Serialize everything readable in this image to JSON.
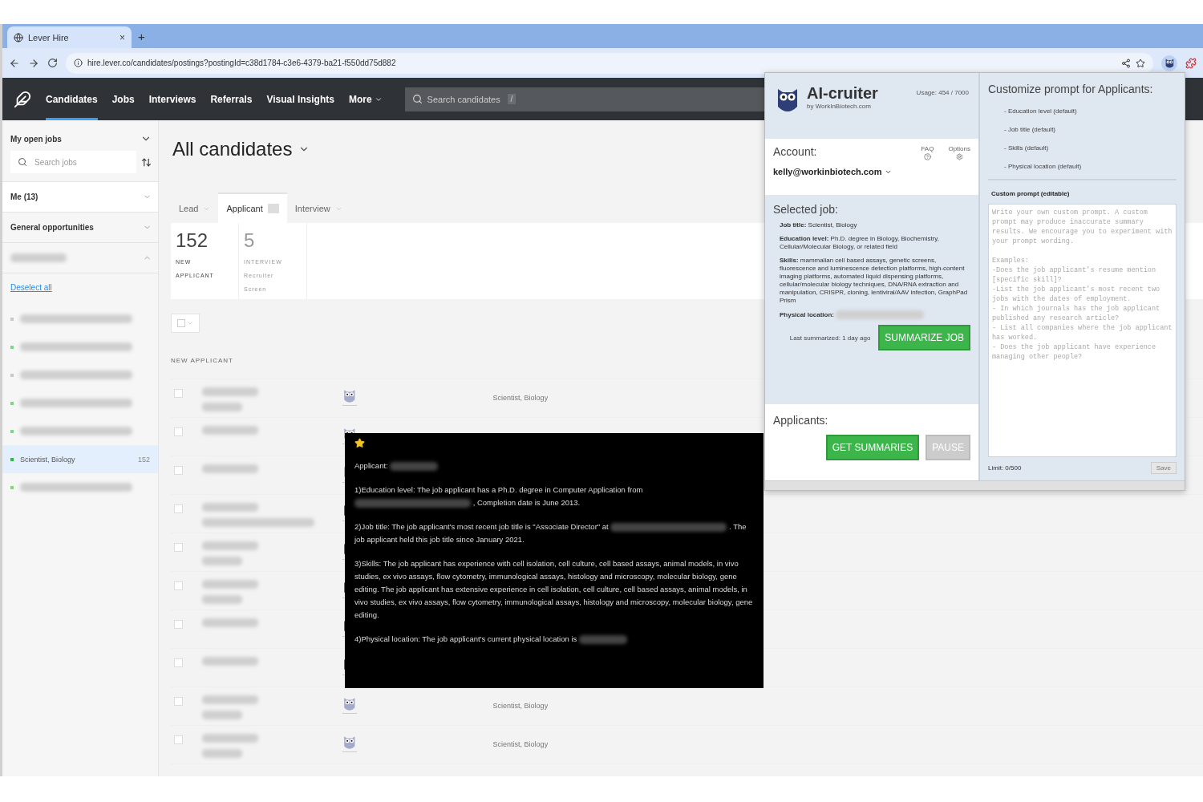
{
  "browser": {
    "tab": {
      "title": "Lever Hire",
      "close": "×"
    },
    "new_tab": "+",
    "url": "hire.lever.co/candidates/postings?postingId=c38d1784-c3e6-4379-ba21-f550dd75d882"
  },
  "nav": {
    "items": [
      {
        "label": "Candidates",
        "selected": true,
        "dropdown": false
      },
      {
        "label": "Jobs",
        "selected": false,
        "dropdown": false
      },
      {
        "label": "Interviews",
        "selected": false,
        "dropdown": false
      },
      {
        "label": "Referrals",
        "selected": false,
        "dropdown": false
      },
      {
        "label": "Visual Insights",
        "selected": false,
        "dropdown": false
      },
      {
        "label": "More",
        "selected": false,
        "dropdown": true
      }
    ],
    "search": {
      "placeholder": "Search candidates",
      "shortcut": "/"
    }
  },
  "sidebar": {
    "header": "My open jobs",
    "search": {
      "placeholder": "Search jobs"
    },
    "groups": [
      {
        "kind": "text",
        "label": "Me (13)",
        "expanded": false
      },
      {
        "kind": "text",
        "label": "General opportunities",
        "expanded": false
      },
      {
        "kind": "redacted",
        "expanded": true
      }
    ],
    "deselect": "Deselect all",
    "jobs": [
      {
        "kind": "redacted",
        "color": "#c8c8c8",
        "selected": false
      },
      {
        "kind": "redacted",
        "color": "#7fd67f",
        "selected": false
      },
      {
        "kind": "redacted",
        "color": "#c8c8c8",
        "selected": false
      },
      {
        "kind": "redacted",
        "color": "#7fd67f",
        "selected": false
      },
      {
        "kind": "redacted",
        "color": "#7fd67f",
        "selected": false
      },
      {
        "kind": "text",
        "title": "Scientist, Biology",
        "count": "152",
        "color": "#22c03c",
        "selected": true
      },
      {
        "kind": "redacted",
        "color": "#7fd67f",
        "selected": false
      }
    ]
  },
  "main": {
    "title": "All candidates",
    "stages": [
      {
        "label": "Lead",
        "selected": false,
        "badge": false
      },
      {
        "label": "Applicant",
        "selected": true,
        "badge": true
      },
      {
        "label": "Interview",
        "selected": false,
        "badge": false
      }
    ],
    "stats": [
      {
        "count": "152",
        "lines": [
          "NEW",
          "APPLICANT"
        ],
        "faded": false
      },
      {
        "count": "5",
        "lines": [
          "INTERVIEW",
          "Recruiter",
          "Screen"
        ],
        "faded": true
      }
    ],
    "select_all": {
      "checked": false
    },
    "section": "NEW APPLICANT",
    "rows": [
      {
        "checked": false,
        "subtitle": true,
        "summarized": false,
        "job": "Scientist, Biology"
      },
      {
        "checked": false,
        "subtitle": false,
        "summarized": false
      },
      {
        "checked": false,
        "subtitle": false,
        "summarized": false
      },
      {
        "checked": false,
        "subtitle": true,
        "summarized": true
      },
      {
        "checked": false,
        "subtitle": true,
        "summarized": true
      },
      {
        "checked": false,
        "subtitle": true,
        "summarized": true
      },
      {
        "checked": false,
        "subtitle": false,
        "summarized": true
      },
      {
        "checked": false,
        "subtitle": false,
        "summarized": true
      },
      {
        "checked": false,
        "subtitle": true,
        "summarized": false,
        "job": "Scientist, Biology"
      },
      {
        "checked": false,
        "subtitle": true,
        "summarized": false,
        "job": "Scientist, Biology"
      }
    ]
  },
  "summary_popup": {
    "starred": true,
    "paragraphs": [
      [
        {
          "kind": "text",
          "text": "Applicant:"
        },
        {
          "kind": "redacted"
        }
      ],
      [
        {
          "kind": "text",
          "text": "1)Education level: The job applicant has a Ph.D. degree in Computer Application from"
        },
        {
          "kind": "redacted"
        },
        {
          "kind": "text",
          "text": ", Completion date is June 2013."
        }
      ],
      [
        {
          "kind": "text",
          "text": "2)Job title: The job applicant's most recent job title is \"Associate Director\" at"
        },
        {
          "kind": "redacted"
        },
        {
          "kind": "text",
          "text": ". The job applicant held this job title since January 2021."
        }
      ],
      [
        {
          "kind": "text",
          "text": "3)Skills: The job applicant has experience with cell isolation, cell culture, cell based assays, animal models, in vivo studies, ex vivo assays, flow cytometry, immunological assays, histology and microscopy, molecular biology, gene editing. The job applicant has extensive experience in cell isolation, cell culture, cell based assays, animal models, in vivo studies, ex vivo assays, flow cytometry, immunological assays, histology and microscopy, molecular biology, gene editing."
        }
      ],
      [
        {
          "kind": "text",
          "text": "4)Physical location: The job applicant's current physical location is"
        },
        {
          "kind": "redacted"
        }
      ]
    ]
  },
  "extension": {
    "title": "AI-cruiter",
    "byline": "by WorkInBiotech.com",
    "usage": "Usage: 454 / 7000",
    "account": {
      "label": "Account:",
      "email": "kelly@workinbiotech.com",
      "links": [
        {
          "label": "FAQ",
          "kind": "help"
        },
        {
          "label": "Options",
          "kind": "settings"
        }
      ]
    },
    "job": {
      "heading": "Selected job:",
      "fields": [
        {
          "text": "**Job title:** Scientist, Biology",
          "redacted": false
        },
        {
          "text": "**Education level:** Ph.D. degree in Biology, Biochemistry, Cellular/Molecular Biology, or related field",
          "redacted": false
        },
        {
          "text": "**Skills:** mammalian cell based assays, genetic screens, fluorescence and luminescence detection platforms, high-content imaging platforms, automated liquid dispensing platforms, cellular/molecular biology techniques, DNA/RNA extraction and manipulation, CRISPR, cloning, lentiviral/AAV infection, GraphPad Prism",
          "redacted": false
        },
        {
          "text": "**Physical location:**",
          "redacted": true
        }
      ],
      "last": "Last summarized: 1 day ago",
      "button": "SUMMARIZE JOB"
    },
    "applicants": {
      "heading": "Applicants:",
      "buttons": [
        {
          "label": "GET SUMMARIES",
          "disabled": false
        },
        {
          "label": "PAUSE",
          "disabled": true
        }
      ]
    },
    "prompt": {
      "heading": "Customize prompt for Applicants:",
      "defaults": [
        "- Education level (default)",
        "- Job title (default)",
        "- Skills (default)",
        "- Physical location (default)"
      ],
      "custom_label": "Custom prompt (editable)",
      "placeholder": "Write your own custom prompt. A custom prompt may produce inaccurate summary results. We encourage you to experiment with your prompt wording.\n\nExamples:\n-Does the job applicant's resume mention [specific skill]?\n-List the job applicant's most recent two jobs with the dates of employment.\n- In which journals has the job applicant published any research article?\n- List all companies where the job applicant has worked.\n- Does the job applicant have experience managing other people?",
      "limit": "Limit: 0/500",
      "save": {
        "label": "Save",
        "disabled": true
      }
    }
  }
}
